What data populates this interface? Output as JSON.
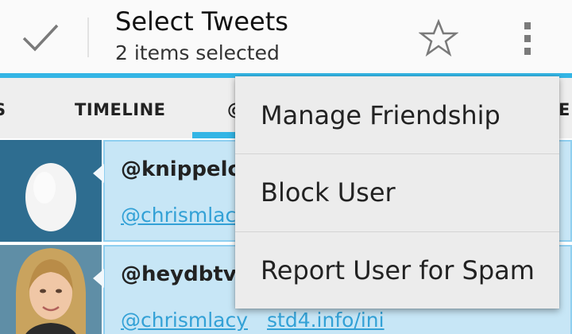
{
  "action_bar": {
    "title": "Select Tweets",
    "subtitle": "2 items selected",
    "done_icon": "checkmark-icon",
    "star_icon": "star-outline-icon",
    "overflow_icon": "overflow-menu-icon",
    "accent_color": "#33b5e5"
  },
  "tabs": {
    "left_partial": "S",
    "timeline": "TIMELINE",
    "mentions": "@",
    "right_partial": "E",
    "active": "mentions"
  },
  "tweets": [
    {
      "handle": "@knippelc",
      "mention": "@chrismlac",
      "avatar": "egg-avatar"
    },
    {
      "handle": "@heydbtv",
      "mention": "@chrismlacy",
      "link": "std4.info/ini",
      "avatar": "photo-avatar"
    }
  ],
  "menu": {
    "items": [
      "Manage Friendship",
      "Block User",
      "Report User for Spam"
    ]
  }
}
